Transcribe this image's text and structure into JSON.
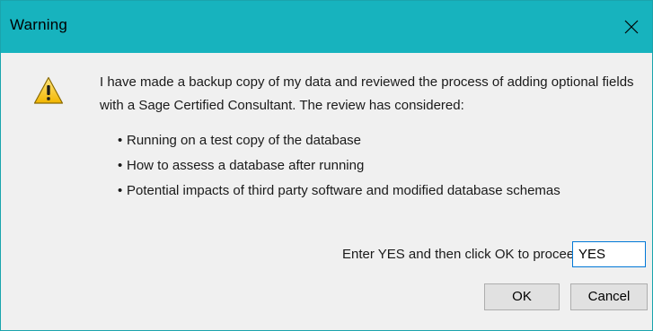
{
  "window": {
    "title": "Warning",
    "close_icon": "close-icon",
    "titlebar_color": "#17b3be"
  },
  "icon": "warning-icon",
  "message": {
    "intro": "I have made a backup copy of my data and reviewed the process of adding optional fields with a Sage Certified Consultant. The review has considered:",
    "bullets": [
      "Running on a test copy of the database",
      "How to assess a database after running",
      "Potential impacts of third party software and modified database schemas"
    ]
  },
  "confirm": {
    "label": "Enter YES and then click OK to proceed",
    "value": "YES"
  },
  "buttons": {
    "ok": "OK",
    "cancel": "Cancel"
  }
}
